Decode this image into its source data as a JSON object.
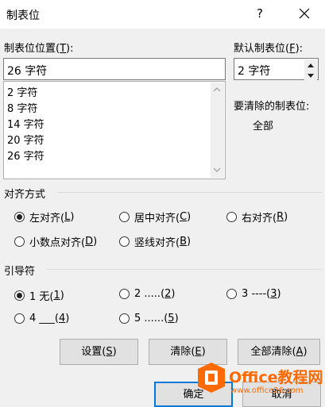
{
  "window": {
    "title": "制表位",
    "help_label": "?"
  },
  "tab_stop_position": {
    "label_prefix": "制表位位置(",
    "label_key": "T",
    "label_suffix": "):",
    "value": "26 字符"
  },
  "tab_list": {
    "items": [
      "2 字符",
      "8 字符",
      "14 字符",
      "20 字符",
      "26 字符"
    ]
  },
  "default_tab": {
    "label_prefix": "默认制表位(",
    "label_key": "F",
    "label_suffix": "):",
    "value": "2 字符"
  },
  "clear": {
    "label": "要清除的制表位:",
    "value": "全部"
  },
  "alignment": {
    "label": "对齐方式",
    "options": [
      {
        "text": "左对齐(",
        "key": "L",
        "end": ")",
        "selected": true
      },
      {
        "text": "居中对齐(",
        "key": "C",
        "end": ")",
        "selected": false
      },
      {
        "text": "右对齐(",
        "key": "R",
        "end": ")",
        "selected": false
      },
      {
        "text": "小数点对齐(",
        "key": "D",
        "end": ")",
        "selected": false
      },
      {
        "text": "竖线对齐(",
        "key": "B",
        "end": ")",
        "selected": false
      }
    ]
  },
  "leader": {
    "label": "引导符",
    "options": [
      {
        "text": "1 无(",
        "key": "1",
        "end": ")",
        "selected": true
      },
      {
        "text": "2 .....(",
        "key": "2",
        "end": ")",
        "selected": false
      },
      {
        "text": "3 ----(",
        "key": "3",
        "end": ")",
        "selected": false
      },
      {
        "text": "4 ___(",
        "key": "4",
        "end": ")",
        "selected": false
      },
      {
        "text": "5 ......(",
        "key": "5",
        "end": ")",
        "selected": false
      }
    ]
  },
  "buttons": {
    "set": {
      "text": "设置(",
      "key": "S",
      "end": ")"
    },
    "clear": {
      "text": "清除(",
      "key": "E",
      "end": ")"
    },
    "clear_all": {
      "text": "全部清除(",
      "key": "A",
      "end": ")"
    },
    "ok": "确定",
    "cancel": "取消"
  },
  "watermark": {
    "brand": "Office教程网",
    "url": "www.office26.com",
    "brand_color": "#ff6a00"
  }
}
